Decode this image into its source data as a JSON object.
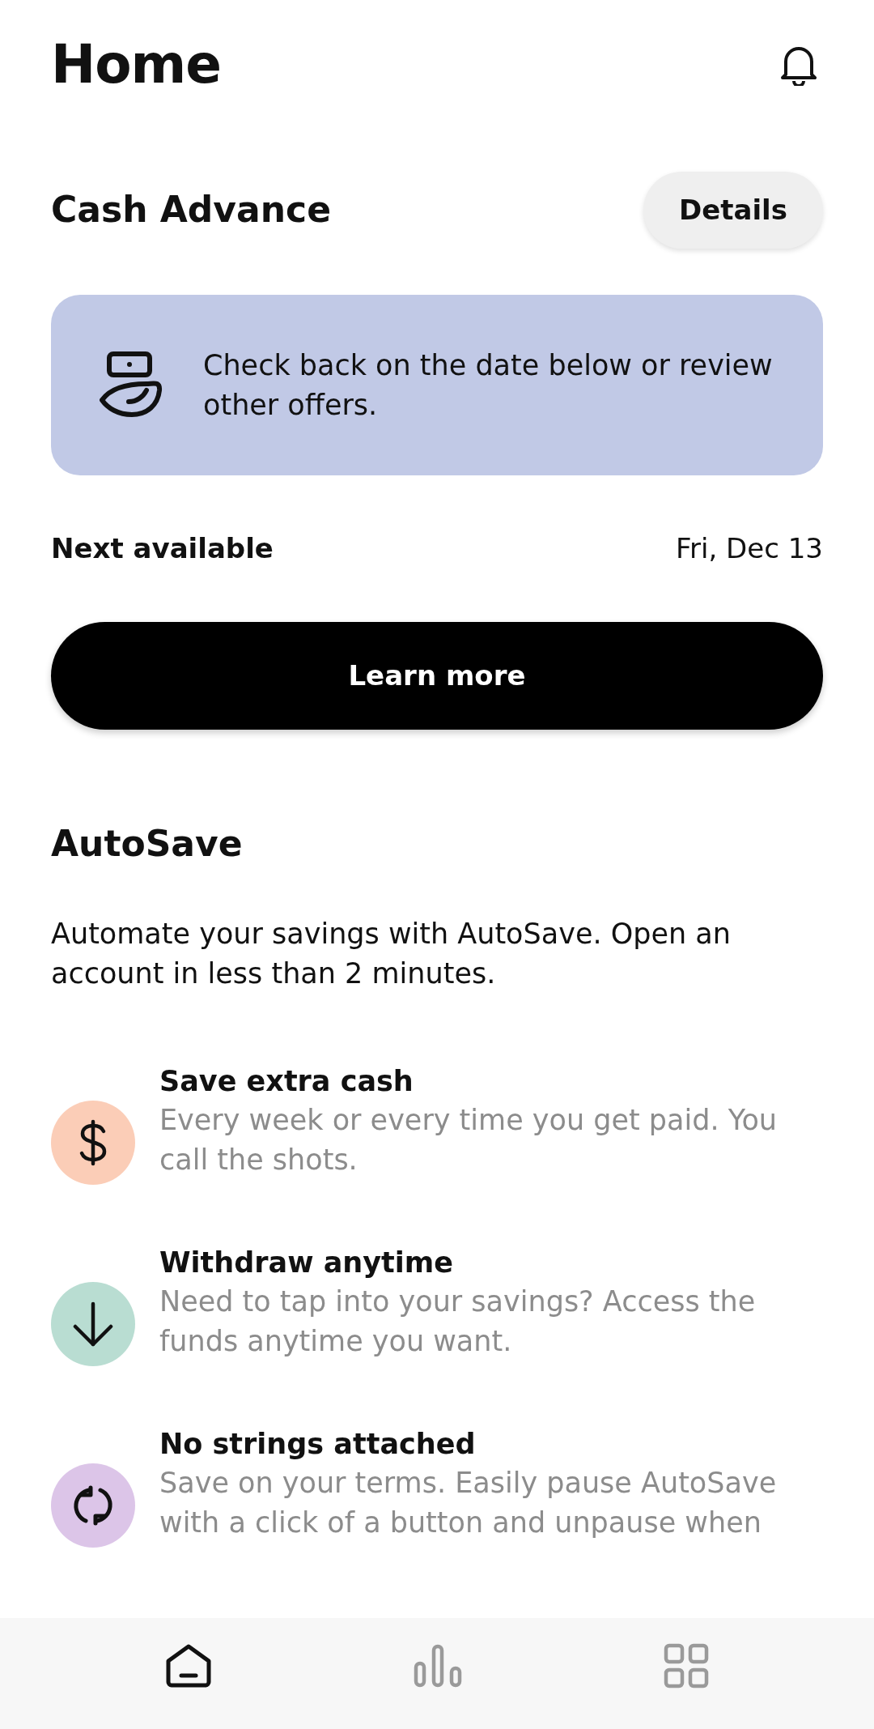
{
  "header": {
    "title": "Home"
  },
  "cash_advance": {
    "title": "Cash Advance",
    "details_button": "Details",
    "banner": {
      "text": "Check back on the date below or review other offers."
    },
    "next_available": {
      "label": "Next available",
      "value": "Fri, Dec 13"
    },
    "cta": "Learn more"
  },
  "autosave": {
    "title": "AutoSave",
    "intro": "Automate your savings with AutoSave. Open an account in less than 2 minutes.",
    "features": [
      {
        "kind": "dollar",
        "color": "#fbcdb7",
        "title": "Save extra cash",
        "description": "Every week or every time you get paid. You call the shots."
      },
      {
        "kind": "down",
        "color": "#b9ddd2",
        "title": "Withdraw anytime",
        "description": "Need to tap into your savings? Access the funds anytime you want."
      },
      {
        "kind": "cycle",
        "color": "#dcc5e8",
        "title": "No strings attached",
        "description": "Save on your terms. Easily pause AutoSave with a click of a button and unpause when"
      }
    ]
  },
  "bottom_nav": [
    {
      "kind": "home",
      "selected": true
    },
    {
      "kind": "chart",
      "selected": false
    },
    {
      "kind": "grid",
      "selected": false
    }
  ]
}
